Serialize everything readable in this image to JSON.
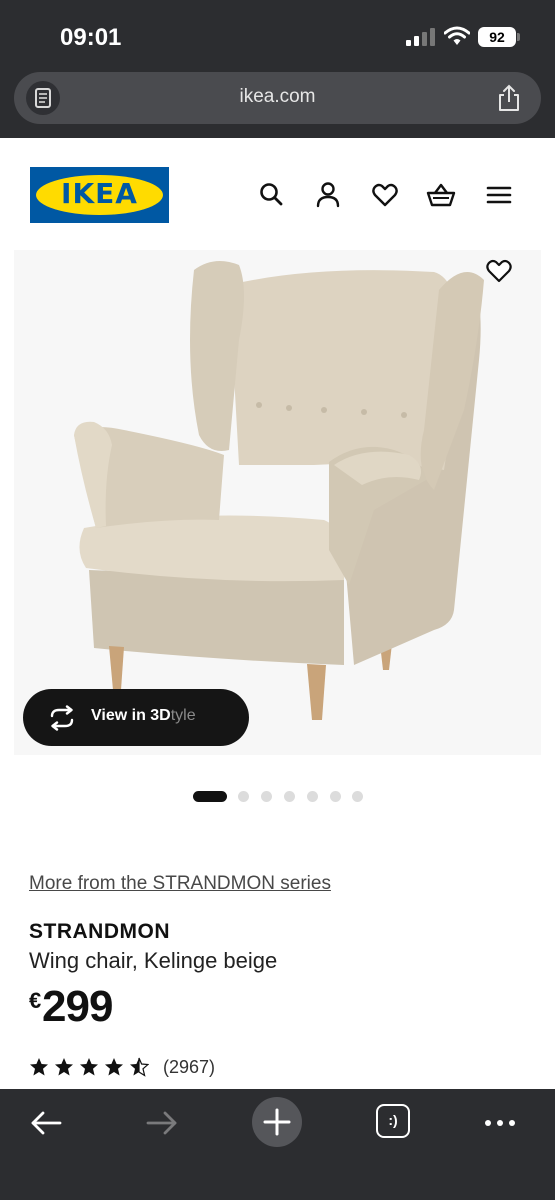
{
  "status_bar": {
    "time": "09:01",
    "battery": "92",
    "icons": [
      "signal-icon",
      "wifi-icon",
      "battery-icon"
    ]
  },
  "browser": {
    "url": "ikea.com",
    "reader_icon": "reader-mode-icon",
    "share_icon": "share-icon"
  },
  "header": {
    "logo_text": "IKEA",
    "icons": [
      "search-icon",
      "account-icon",
      "wishlist-icon",
      "cart-icon",
      "menu-icon"
    ],
    "brand_colors": {
      "blue": "#0058a3",
      "yellow": "#ffdb00"
    }
  },
  "gallery": {
    "image_subject": "beige wing chair",
    "view_3d_label": "View in 3D",
    "view_3d_label_overflow": "tyle",
    "favorite_icon": "heart-icon",
    "total_images": 7,
    "active_index": 0
  },
  "product": {
    "series_link": "More from the STRANDMON series",
    "name": "STRANDMON",
    "description": "Wing chair, Kelinge beige",
    "currency": "€",
    "price": "299",
    "rating": 4.5,
    "rating_max": 5,
    "review_count": "(2967)"
  },
  "toolbar": {
    "icons": [
      "back-arrow-icon",
      "forward-arrow-icon",
      "new-tab-icon",
      "tabs-icon",
      "more-icon"
    ],
    "tabs_label": ":)"
  }
}
